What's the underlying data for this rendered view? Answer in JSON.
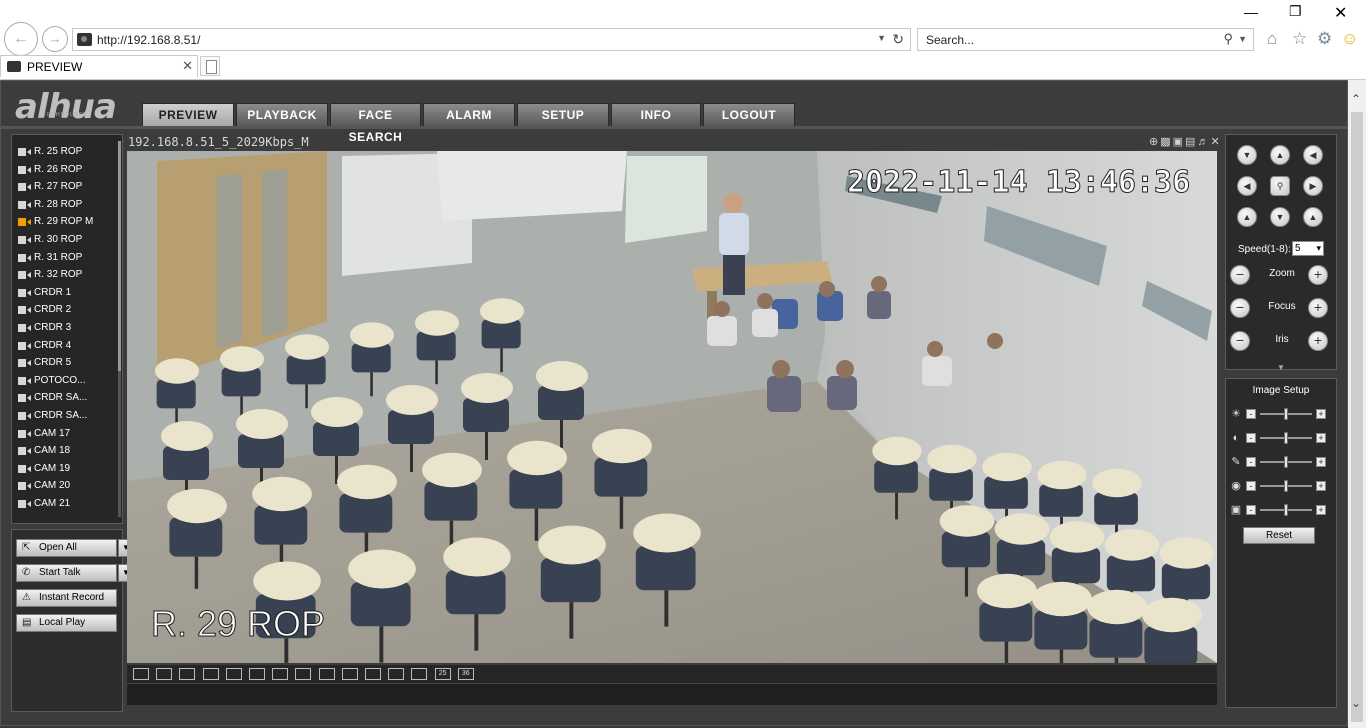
{
  "browser": {
    "url": "http://192.168.8.51/",
    "search_placeholder": "Search...",
    "tab_title": "PREVIEW"
  },
  "app": {
    "menu": [
      "PREVIEW",
      "PLAYBACK",
      "FACE SEARCH",
      "ALARM",
      "SETUP",
      "INFO",
      "LOGOUT"
    ],
    "active_menu": "PREVIEW"
  },
  "channels": [
    {
      "label": "R. 25 ROP"
    },
    {
      "label": "R. 26 ROP"
    },
    {
      "label": "R. 27 ROP"
    },
    {
      "label": "R. 28 ROP"
    },
    {
      "label": "R. 29 ROP   M",
      "active": true
    },
    {
      "label": "R. 30 ROP"
    },
    {
      "label": "R. 31 ROP"
    },
    {
      "label": "R. 32 ROP"
    },
    {
      "label": "CRDR 1"
    },
    {
      "label": "CRDR 2"
    },
    {
      "label": "CRDR 3"
    },
    {
      "label": "CRDR 4"
    },
    {
      "label": "CRDR 5"
    },
    {
      "label": "POTOCO..."
    },
    {
      "label": "CRDR SA..."
    },
    {
      "label": "CRDR SA..."
    },
    {
      "label": "CAM 17"
    },
    {
      "label": "CAM 18"
    },
    {
      "label": "CAM 19"
    },
    {
      "label": "CAM 20"
    },
    {
      "label": "CAM 21"
    }
  ],
  "controls": {
    "open_all": "Open All",
    "start_talk": "Start Talk",
    "instant_record": "Instant Record",
    "local_play": "Local Play"
  },
  "video": {
    "stream_title": "192.168.8.51_5_2029Kbps_M",
    "timestamp": "2022-11-14 13:46:36",
    "overlay_name": "R. 29 ROP"
  },
  "split_buttons": [
    "",
    "",
    "",
    "",
    "",
    "",
    "",
    "",
    "",
    "",
    "",
    "",
    "",
    "25",
    "36"
  ],
  "ptz": {
    "speed_label": "Speed(1-8):",
    "speed_value": "5",
    "zoom": "Zoom",
    "focus": "Focus",
    "iris": "Iris"
  },
  "image_setup": {
    "title": "Image Setup",
    "reset": "Reset"
  }
}
